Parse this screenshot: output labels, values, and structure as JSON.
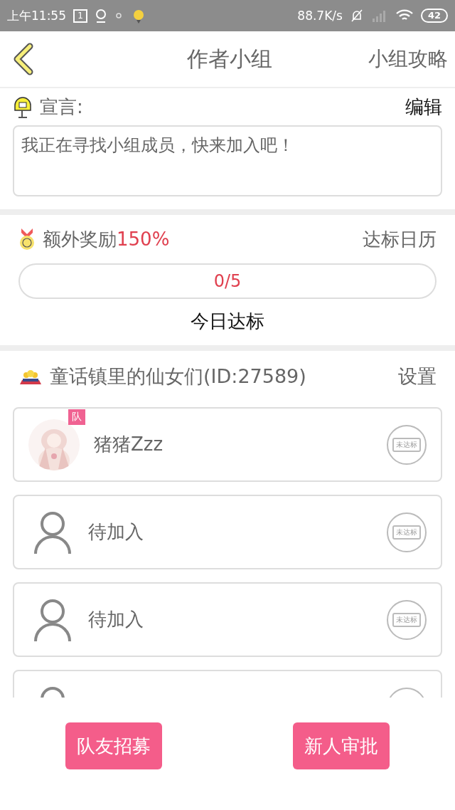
{
  "status_bar": {
    "time": "上午11:55",
    "calendar_day": "1",
    "net_speed": "88.7K/s",
    "battery": "42"
  },
  "header": {
    "title": "作者小组",
    "action": "小组攻略"
  },
  "declaration": {
    "label": "宣言:",
    "edit": "编辑",
    "text": "我正在寻找小组成员，快来加入吧！"
  },
  "reward": {
    "label": "额外奖励",
    "percent": "150%",
    "calendar": "达标日历",
    "progress": {
      "reading": "0/5"
    },
    "caption": "今日达标"
  },
  "group": {
    "name": "童话镇里的仙女们(ID:27589)",
    "settings": "设置",
    "members": [
      {
        "kind": "user",
        "name": "猪猪Zzz",
        "badge": "队",
        "stamp": "未达标"
      },
      {
        "kind": "empty",
        "name": "待加入",
        "stamp": "未达标"
      },
      {
        "kind": "empty",
        "name": "待加入",
        "stamp": "未达标"
      },
      {
        "kind": "empty"
      }
    ]
  },
  "buttons": [
    "队友招募",
    "新人审批"
  ]
}
